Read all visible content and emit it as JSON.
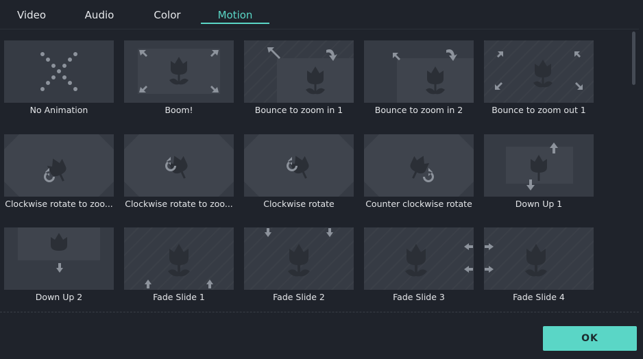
{
  "tabs": [
    {
      "label": "Video"
    },
    {
      "label": "Audio"
    },
    {
      "label": "Color"
    },
    {
      "label": "Motion"
    }
  ],
  "active_tab": "Motion",
  "accent_color": "#5ad6c6",
  "items": [
    {
      "label": "No Animation"
    },
    {
      "label": "Boom!"
    },
    {
      "label": "Bounce to zoom in 1"
    },
    {
      "label": "Bounce to zoom in 2"
    },
    {
      "label": "Bounce to zoom out 1"
    },
    {
      "label": "Clockwise rotate to zoo..."
    },
    {
      "label": "Clockwise rotate to zoo..."
    },
    {
      "label": "Clockwise rotate"
    },
    {
      "label": "Counter clockwise rotate"
    },
    {
      "label": "Down Up 1"
    },
    {
      "label": "Down Up 2"
    },
    {
      "label": "Fade Slide 1"
    },
    {
      "label": "Fade Slide 2"
    },
    {
      "label": "Fade Slide 3"
    },
    {
      "label": "Fade Slide 4"
    }
  ],
  "ok_label": "OK"
}
